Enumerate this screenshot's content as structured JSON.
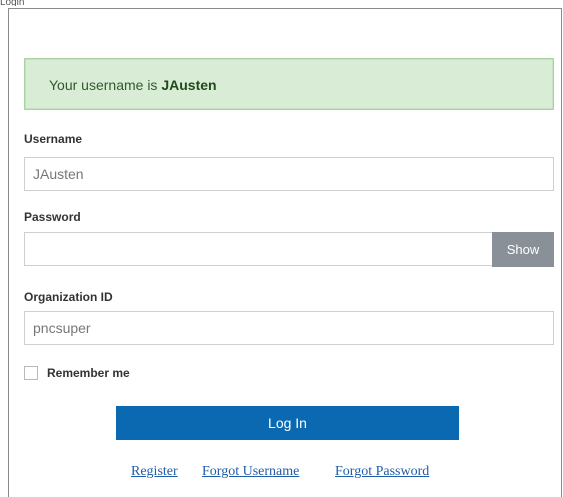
{
  "top_partial_text": "Login",
  "alert": {
    "prefix": "Your username is ",
    "username": "JAusten"
  },
  "username": {
    "label": "Username",
    "value": "JAusten"
  },
  "password": {
    "label": "Password",
    "value": "",
    "show_label": "Show"
  },
  "organization": {
    "label": "Organization ID",
    "value": "pncsuper"
  },
  "remember": {
    "label": "Remember me",
    "checked": false
  },
  "login_button": "Log In",
  "links": {
    "register": "Register",
    "forgot_username": "Forgot Username",
    "forgot_password": "Forgot Password"
  }
}
